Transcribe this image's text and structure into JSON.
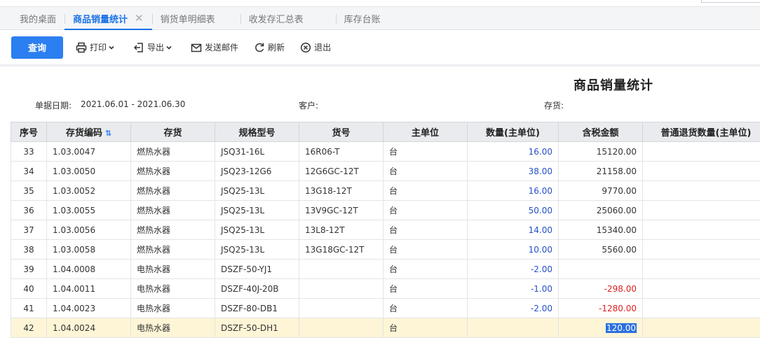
{
  "tabs": [
    {
      "label": "我的桌面",
      "active": false
    },
    {
      "label": "商品销量统计",
      "active": true,
      "close": "✕"
    },
    {
      "label": "销货单明细表",
      "active": false
    },
    {
      "label": "收发存汇总表",
      "active": false
    },
    {
      "label": "库存台账",
      "active": false
    }
  ],
  "toolbar": {
    "query_label": "查询",
    "print_label": "打印",
    "export_label": "导出",
    "email_label": "发送邮件",
    "refresh_label": "刷新",
    "exit_label": "退出"
  },
  "report": {
    "title": "商品销量统计",
    "date_label": "单据日期:",
    "date_value": "2021.06.01 - 2021.06.30",
    "customer_label": "客户:",
    "stock_label": "存货:"
  },
  "colors": {
    "accent": "#2b7ff0",
    "negative": "#e02020",
    "qty": "#2550c8",
    "selected_row": "#fdf5d6"
  },
  "columns": [
    "序号",
    "存货编码",
    "存货",
    "规格型号",
    "货号",
    "主单位",
    "数量(主单位)",
    "含税金额",
    "普通退货数量(主单位)"
  ],
  "rows": [
    {
      "no": "33",
      "code": "1.03.0047",
      "item": "燃热水器",
      "spec": "JSQ31-16L",
      "art": "16R06-T",
      "unit": "台",
      "qty": "16.00",
      "amount": "15120.00",
      "ret": ""
    },
    {
      "no": "34",
      "code": "1.03.0050",
      "item": "燃热水器",
      "spec": "JSQ23-12G6",
      "art": "12G6GC-12T",
      "unit": "台",
      "qty": "38.00",
      "amount": "21158.00",
      "ret": ""
    },
    {
      "no": "35",
      "code": "1.03.0052",
      "item": "燃热水器",
      "spec": "JSQ25-13L",
      "art": "13G18-12T",
      "unit": "台",
      "qty": "16.00",
      "amount": "9770.00",
      "ret": ""
    },
    {
      "no": "36",
      "code": "1.03.0055",
      "item": "燃热水器",
      "spec": "JSQ25-13L",
      "art": "13V9GC-12T",
      "unit": "台",
      "qty": "50.00",
      "amount": "25060.00",
      "ret": ""
    },
    {
      "no": "37",
      "code": "1.03.0056",
      "item": "燃热水器",
      "spec": "JSQ25-13L",
      "art": "13L8-12T",
      "unit": "台",
      "qty": "14.00",
      "amount": "15340.00",
      "ret": ""
    },
    {
      "no": "38",
      "code": "1.03.0058",
      "item": "燃热水器",
      "spec": "JSQ25-13L",
      "art": "13G18GC-12T",
      "unit": "台",
      "qty": "10.00",
      "amount": "5560.00",
      "ret": ""
    },
    {
      "no": "39",
      "code": "1.04.0008",
      "item": "电热水器",
      "spec": "DSZF-50-YJ1",
      "art": "",
      "unit": "台",
      "qty": "-2.00",
      "amount": "",
      "ret": ""
    },
    {
      "no": "40",
      "code": "1.04.0011",
      "item": "电热水器",
      "spec": "DSZF-40J-20B",
      "art": "",
      "unit": "台",
      "qty": "-1.00",
      "amount": "-298.00",
      "ret": ""
    },
    {
      "no": "41",
      "code": "1.04.0023",
      "item": "电热水器",
      "spec": "DSZF-80-DB1",
      "art": "",
      "unit": "台",
      "qty": "-2.00",
      "amount": "-1280.00",
      "ret": ""
    },
    {
      "no": "42",
      "code": "1.04.0024",
      "item": "电热水器",
      "spec": "DSZF-50-DH1",
      "art": "",
      "unit": "台",
      "qty": "",
      "amount": "120.00",
      "ret": "",
      "selected": true
    }
  ]
}
